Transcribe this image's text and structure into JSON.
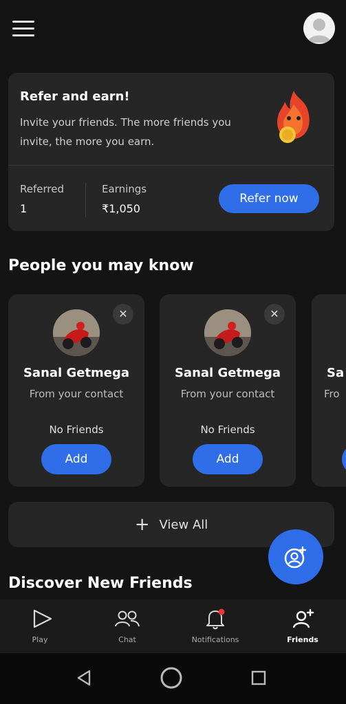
{
  "header": {
    "menu_icon": "hamburger-menu-icon",
    "avatar_icon": "user-avatar-icon"
  },
  "refer": {
    "title": "Refer and earn!",
    "description": "Invite your friends. The more friends you invite, the more you earn.",
    "referred_label": "Referred",
    "referred_value": "1",
    "earnings_label": "Earnings",
    "earnings_value": "₹1,050",
    "button_label": "Refer now"
  },
  "people": {
    "title": "People you may know",
    "cards": [
      {
        "name": "Sanal Getmega",
        "subtitle": "From your contact",
        "friends": "No Friends",
        "button": "Add"
      },
      {
        "name": "Sanal Getmega",
        "subtitle": "From your contact",
        "friends": "No Friends",
        "button": "Add"
      },
      {
        "name": "Sa",
        "subtitle": "Fro"
      }
    ],
    "view_all": "View All"
  },
  "discover": {
    "title": "Discover New Friends"
  },
  "tabs": [
    {
      "label": "Play",
      "icon": "play-icon"
    },
    {
      "label": "Chat",
      "icon": "chat-people-icon"
    },
    {
      "label": "Notifications",
      "icon": "bell-icon"
    },
    {
      "label": "Friends",
      "icon": "add-friend-icon",
      "active": true
    }
  ],
  "colors": {
    "background": "#141414",
    "card": "#262626",
    "accent": "#2f6ee8"
  }
}
